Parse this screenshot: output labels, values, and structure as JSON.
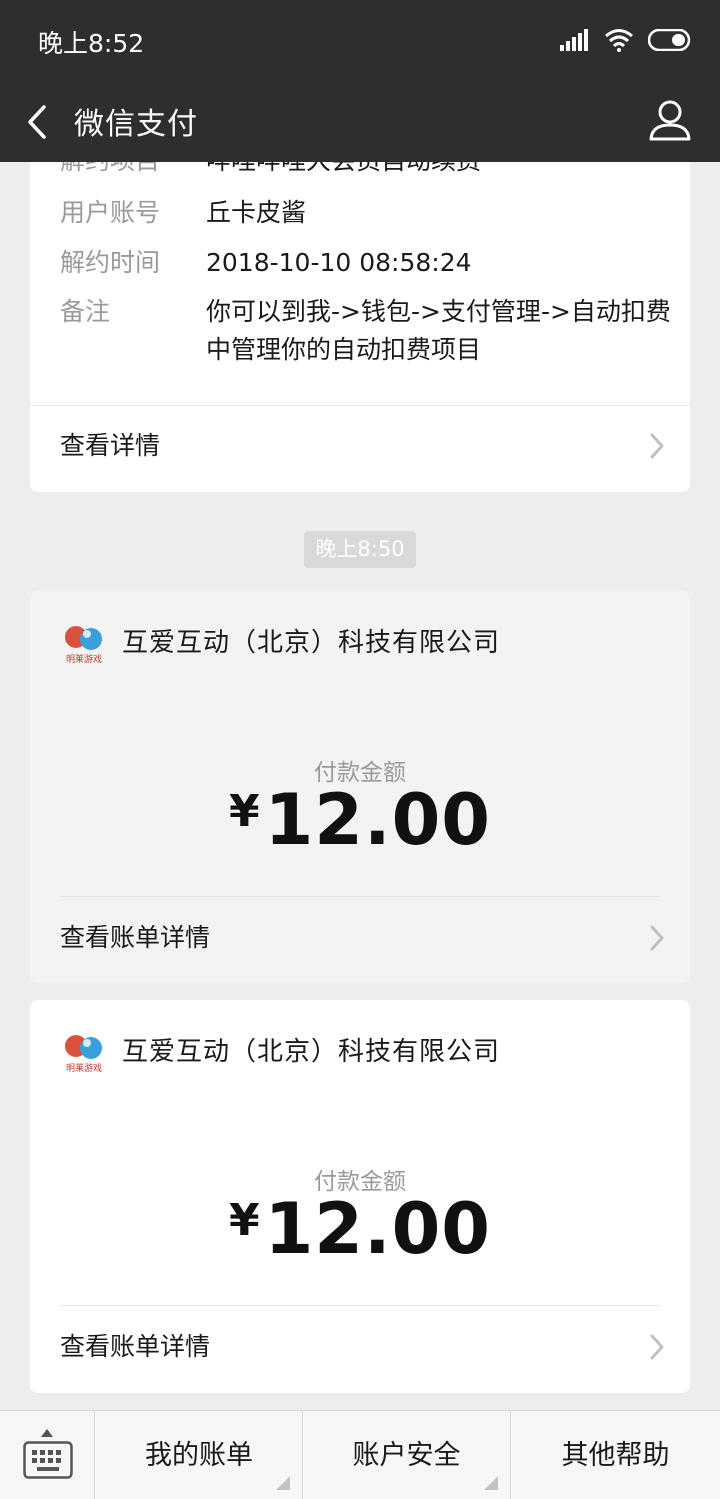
{
  "status_bar": {
    "time": "晚上8:52"
  },
  "nav": {
    "title": "微信支付"
  },
  "top_card": {
    "partial_row": {
      "label": "解约项目",
      "value": "哔哩哔哩大会员自动续费"
    },
    "rows": [
      {
        "label": "用户账号",
        "value": "丘卡皮酱"
      },
      {
        "label": "解约时间",
        "value": "2018-10-10 08:58:24"
      },
      {
        "label": "备注",
        "value": "你可以到我->钱包->支付管理->自动扣费中管理你的自动扣费项目"
      }
    ],
    "link": "查看详情"
  },
  "time_separator": "晚上8:50",
  "payments": [
    {
      "merchant": "互爱互动（北京）科技有限公司",
      "logo_text": "明莱游戏",
      "amount_label": "付款金额",
      "currency": "¥",
      "amount": "12.00",
      "link": "查看账单详情"
    },
    {
      "merchant": "互爱互动（北京）科技有限公司",
      "logo_text": "明莱游戏",
      "amount_label": "付款金额",
      "currency": "¥",
      "amount": "12.00",
      "link": "查看账单详情"
    }
  ],
  "bottom_menu": {
    "items": [
      "我的账单",
      "账户安全",
      "其他帮助"
    ]
  },
  "icons": {
    "back": "back-arrow-icon",
    "user": "user-icon",
    "chevron": "chevron-right-icon",
    "keyboard": "keyboard-icon"
  },
  "colors": {
    "nav_background": "#2e2e2e",
    "page_background": "#ededed",
    "label_grey": "#9a9a9a"
  }
}
